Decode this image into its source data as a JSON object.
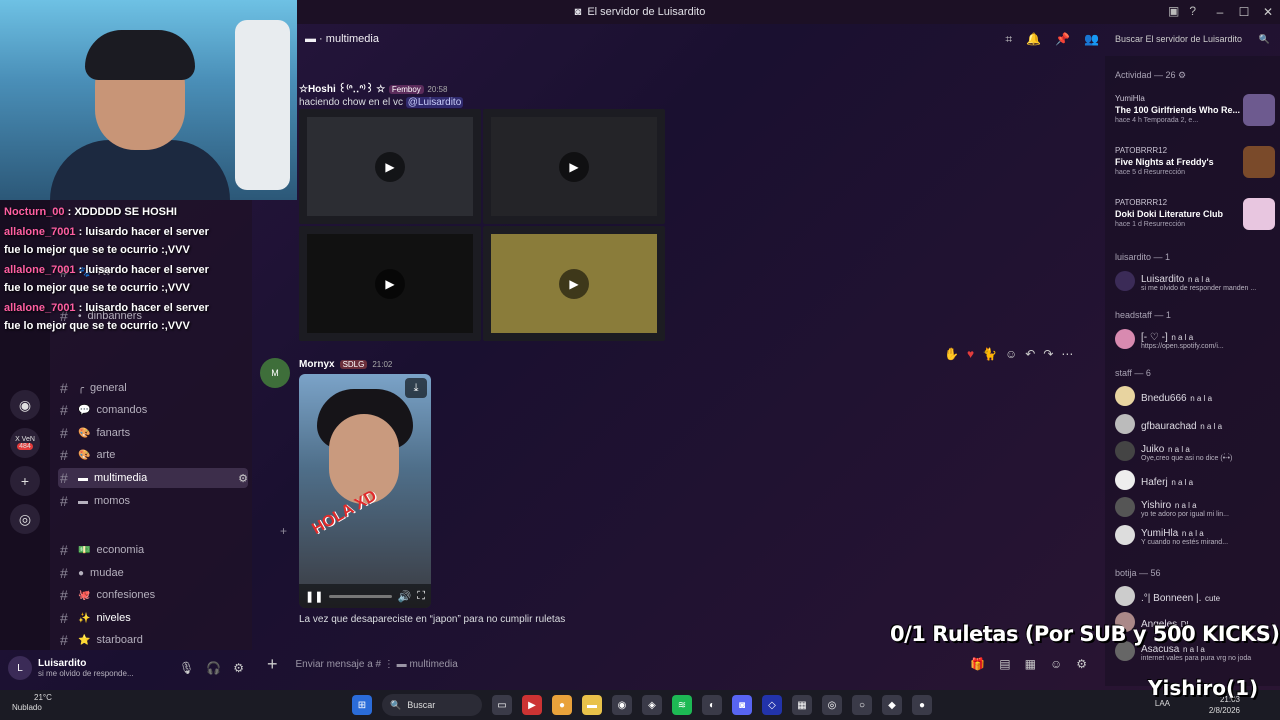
{
  "window": {
    "title": "El servidor de Luisardito"
  },
  "stream_chat": [
    {
      "user": "Nocturn_00",
      "text": ": XDDDDD SE HOSHI"
    },
    {
      "user": "allalone_7001",
      "text": ": luisardo hacer el server fue lo mejor que se te ocurrio :,VVV"
    },
    {
      "user": "allalone_7001",
      "text": ": luisardo hacer el server fue lo mejor que se te ocurrio :,VVV"
    },
    {
      "user": "allalone_7001",
      "text": ": luisardo hacer el server fue lo mejor que se te ocurrio :,VVV"
    }
  ],
  "server_badge": "484",
  "server_xvn": "X VeN",
  "channels": [
    {
      "name": "7tv"
    },
    {
      "name": "dinbanners"
    },
    {
      "name": "general"
    },
    {
      "name": "comandos"
    },
    {
      "name": "fanarts"
    },
    {
      "name": "arte"
    },
    {
      "name": "multimedia"
    },
    {
      "name": "momos"
    },
    {
      "name": "economia"
    },
    {
      "name": "mudae"
    },
    {
      "name": "confesiones"
    },
    {
      "name": "niveles"
    },
    {
      "name": "starboard"
    }
  ],
  "user_panel": {
    "name": "Luisardito",
    "status": "si me olvido de responde..."
  },
  "chat_header": {
    "channel": "multimedia",
    "search_placeholder": "Buscar El servidor de Luisardito"
  },
  "message1": {
    "author": "☆Hoshi ꒰⁽ᐢ‥ᐢ⁾꒱ ☆",
    "tag": "Femboy",
    "time": "20:58",
    "text": "haciendo chow en el vc",
    "mention": "@Luisardito"
  },
  "message2": {
    "author": "Mornyx",
    "tag": "SDLG",
    "time": "21:02",
    "video_text": "HOLA XD",
    "caption": "La vez que desapareciste en “japon” para no cumplir ruletas"
  },
  "composer": {
    "placeholder": "Enviar mensaje a #",
    "channel": "multimedia"
  },
  "members": {
    "activity_header": "Actividad — 26",
    "activities": [
      {
        "user": "YumiHla",
        "title": "The 100 Girlfriends Who Re...",
        "meta": "hace 4 h   Temporada 2, e..."
      },
      {
        "user": "PATOBRRR12",
        "title": "Five Nights at Freddy's",
        "meta": "hace 5 d   Resurrección"
      },
      {
        "user": "PATOBRRR12",
        "title": "Doki Doki Literature Club",
        "meta": "hace 1 d   Resurrección"
      }
    ],
    "luisardito_header": "luisardito — 1",
    "luisardito": {
      "name": "Luisardito",
      "badge": "n a l a",
      "sub": "si me olvido de responder manden ..."
    },
    "headstaff_header": "headstaff — 1",
    "headstaff": {
      "name": "[- ♡ -]",
      "badge": "n a l a",
      "sub": "https://open.spotify.com/i..."
    },
    "staff_header": "staff — 6",
    "staff": [
      {
        "name": "Bnedu666",
        "badge": "n a l a",
        "sub": ""
      },
      {
        "name": "gfbaurachad",
        "badge": "n a l a",
        "sub": ""
      },
      {
        "name": "Juiko",
        "badge": "n a l a",
        "sub": "Oye,creo que asi no dice (•́-•̀)"
      },
      {
        "name": "Haferj",
        "badge": "n a l a",
        "sub": ""
      },
      {
        "name": "Yishiro",
        "badge": "n a l a",
        "sub": "yo te adoro por igual mi lin..."
      },
      {
        "name": "YumiHla",
        "badge": "n a l a",
        "sub": "Y cuando no estés mirand..."
      }
    ],
    "botija_header": "botija — 56",
    "botija": [
      {
        "name": ".°| Bonneen |.",
        "badge": "cute",
        "sub": ""
      },
      {
        "name": "Angeles",
        "badge": "DL",
        "sub": ""
      },
      {
        "name": "Asacusa",
        "badge": "n a l a",
        "sub": "internet vales para pura vrg no joda"
      }
    ]
  },
  "overlay": {
    "banner": "0/1 Ruletas (Por SUB y 500 KICKS)",
    "name": "Yishiro(1)"
  },
  "taskbar": {
    "temp": "21°C",
    "weather": "Nublado",
    "search": "Buscar",
    "lang": "LAA",
    "time": "21:03",
    "date": "2/8/2026"
  }
}
